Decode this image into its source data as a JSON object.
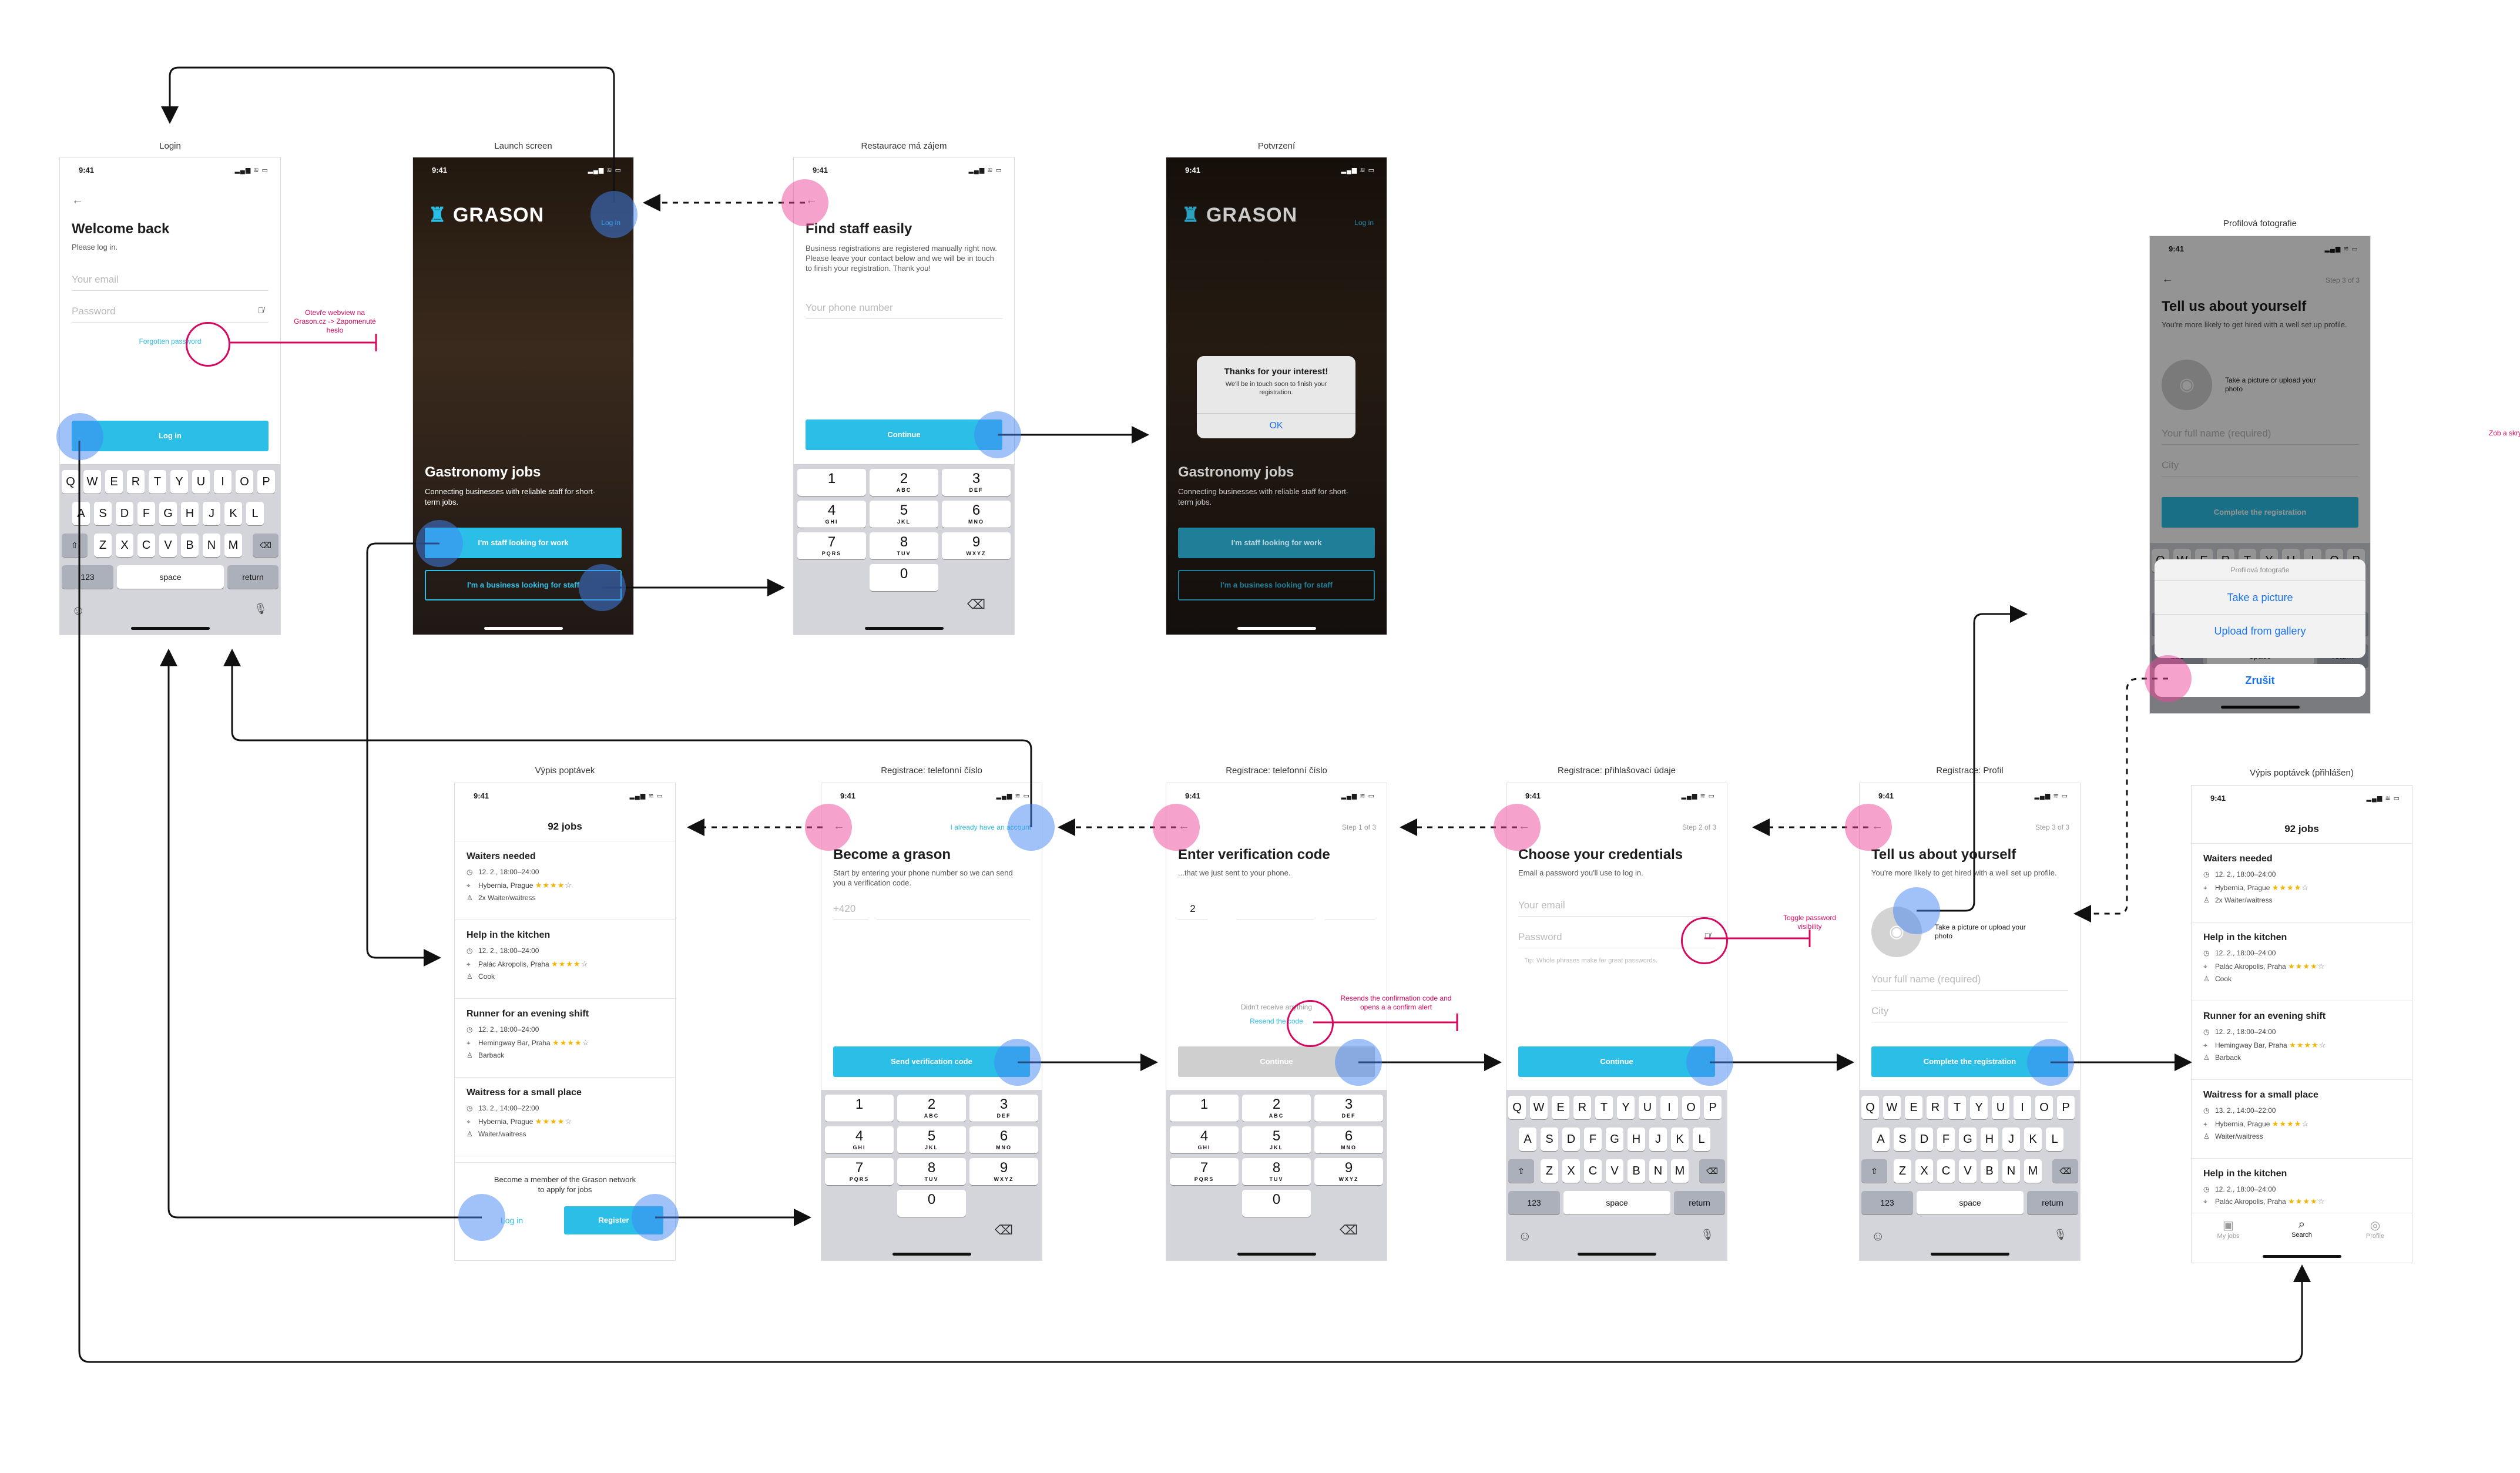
{
  "titles": {
    "login": "Login",
    "launch": "Launch screen",
    "restaurace": "Restaurace má zájem",
    "potvrzeni": "Potvrzení",
    "profilova": "Profilová fotografie",
    "vypis": "Výpis poptávek",
    "reg_phone": "Registrace: telefonní číslo",
    "reg_code": "Registrace: telefonní číslo",
    "reg_cred": "Registrace: přihlašovací údaje",
    "reg_profile": "Registrace: Profil",
    "vypis_logged": "Výpis poptávek (přihlášen)"
  },
  "status": {
    "time": "9:41",
    "icons": "▂▄▆ ≋ ▭"
  },
  "keyboard": {
    "row1": [
      "Q",
      "W",
      "E",
      "R",
      "T",
      "Y",
      "U",
      "I",
      "O",
      "P"
    ],
    "row2": [
      "A",
      "S",
      "D",
      "F",
      "G",
      "H",
      "J",
      "K",
      "L"
    ],
    "row3": [
      "Z",
      "X",
      "C",
      "V",
      "B",
      "N",
      "M"
    ],
    "shift": "⇧",
    "backspace": "⌫",
    "numbers": "123",
    "space": "space",
    "return": "return",
    "emoji": "☺",
    "mic": "🎙"
  },
  "numpad": {
    "keys": [
      {
        "d": "1",
        "l": ""
      },
      {
        "d": "2",
        "l": "ABC"
      },
      {
        "d": "3",
        "l": "DEF"
      },
      {
        "d": "4",
        "l": "GHI"
      },
      {
        "d": "5",
        "l": "JKL"
      },
      {
        "d": "6",
        "l": "MNO"
      },
      {
        "d": "7",
        "l": "PQRS"
      },
      {
        "d": "8",
        "l": "TUV"
      },
      {
        "d": "9",
        "l": "WXYZ"
      },
      {
        "d": "0",
        "l": ""
      }
    ],
    "backspace": "⌫"
  },
  "login": {
    "back": "←",
    "title": "Welcome back",
    "subtitle": "Please log in.",
    "email_placeholder": "Your email",
    "password_placeholder": "Password",
    "eye": "👁̸",
    "forgot": "Forgotten password",
    "login_button": "Log in",
    "note": "Otevře webview na Grason.cz -> Zapomenuté heslo"
  },
  "launch": {
    "logo": "GRASON",
    "login": "Log in",
    "title": "Gastronomy jobs",
    "subtitle": "Connecting businesses with reliable staff for short-term jobs.",
    "staff_button": "I'm staff looking for work",
    "business_button": "I'm a business looking for staff"
  },
  "restaurace": {
    "back": "←",
    "title": "Find staff easily",
    "subtitle": "Business registrations are registered manually right now. Please leave your contact below and we will be in touch to finish your registration. Thank you!",
    "phone_placeholder": "Your phone number",
    "continue": "Continue"
  },
  "potvrzeni": {
    "logo": "GRASON",
    "login": "Log in",
    "alert_title": "Thanks for your interest!",
    "alert_body": "We'll be in touch soon to finish your registration.",
    "alert_ok": "OK",
    "title": "Gastronomy jobs",
    "subtitle": "Connecting businesses with reliable staff for short-term jobs.",
    "staff_button": "I'm staff looking for work",
    "business_button": "I'm a business looking for staff"
  },
  "profilova": {
    "back": "←",
    "step": "Step 3 of 3",
    "title": "Tell us about yourself",
    "subtitle": "You're more likely to get hired with a well set up profile.",
    "photo_hint": "Take a picture or upload your photo",
    "name_placeholder": "Your full name (required)",
    "city_placeholder": "City",
    "complete": "Complete the registration",
    "sheet_title": "Profilová fotografie",
    "take_picture": "Take a picture",
    "upload": "Upload from gallery",
    "cancel": "Zrušit"
  },
  "side_note": "Zob a skry",
  "jobs": {
    "count": "92 jobs",
    "items": [
      {
        "title": "Waiters needed",
        "date": "12. 2., 18:00–24:00",
        "place": "Hybernia, Prague",
        "role": "2x Waiter/waitress",
        "stars": "★★★★",
        "empty": "☆"
      },
      {
        "title": "Help in the kitchen",
        "date": "12. 2., 18:00–24:00",
        "place": "Palác Akropolis, Praha",
        "role": "Cook",
        "stars": "★★★★",
        "empty": "☆"
      },
      {
        "title": "Runner for an evening shift",
        "date": "12. 2., 18:00–24:00",
        "place": "Hemingway Bar, Praha",
        "role": "Barback",
        "stars": "★★★★",
        "empty": "☆"
      },
      {
        "title": "Waitress for a small place",
        "date": "13. 2., 14:00–22:00",
        "place": "Hybernia, Prague",
        "role": "Waiter/waitress",
        "stars": "★★★★",
        "empty": "☆"
      }
    ],
    "extra": {
      "title": "Help in the kitchen",
      "date": "12. 2., 18:00–24:00",
      "place": "Palác Akropolis, Praha",
      "stars": "★★★★",
      "empty": "☆"
    },
    "member_text": "Become a member of the Grason network to apply for jobs",
    "login": "Log in",
    "register": "Register",
    "tabs": {
      "my_jobs": "My jobs",
      "search": "Search",
      "profile": "Profile"
    }
  },
  "reg_phone": {
    "back": "←",
    "have_account": "I already have an account",
    "title": "Become a grason",
    "subtitle": "Start by entering your phone number so we can send you a verification code.",
    "prefix": "+420",
    "send": "Send verification code"
  },
  "reg_code": {
    "back": "←",
    "step": "Step 1 of 3",
    "title": "Enter verification code",
    "subtitle": "...that we just sent to your phone.",
    "digit": "2",
    "didnt": "Didn't receive anything",
    "resend": "Resend the code",
    "continue": "Continue",
    "note": "Resends the confirmation code and opens a a confirm alert"
  },
  "reg_cred": {
    "back": "←",
    "step": "Step 2 of 3",
    "title": "Choose your credentials",
    "subtitle": "Email a password you'll use to log in.",
    "email_placeholder": "Your email",
    "password_placeholder": "Password",
    "tip": "Tip: Whole phrases make for great passwords.",
    "continue": "Continue",
    "note": "Toggle password visibility"
  },
  "reg_profile": {
    "back": "←",
    "step": "Step 3 of 3",
    "title": "Tell us about yourself",
    "subtitle": "You're more likely to get hired with a well set up profile.",
    "photo_hint": "Take a picture or upload your photo",
    "name_placeholder": "Your full name (required)",
    "city_placeholder": "City",
    "complete": "Complete the registration"
  },
  "colors": {
    "accent": "#2bbfe7",
    "pink": "#d6075f",
    "hotspot_blue": "#4285f4",
    "hotspot_pink": "#ec4899"
  }
}
